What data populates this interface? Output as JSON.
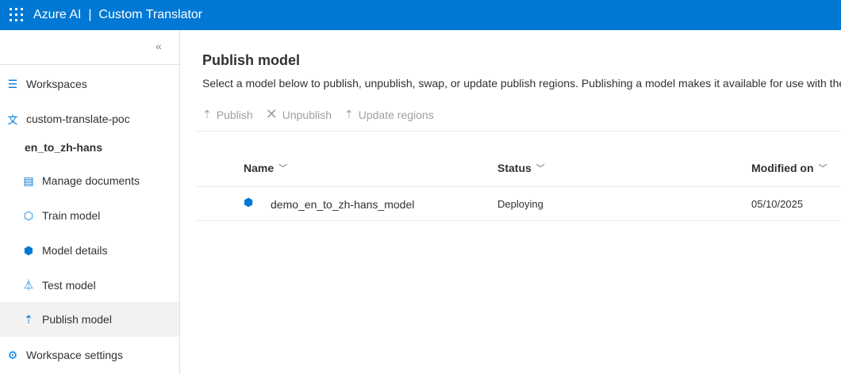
{
  "header": {
    "brand": "Azure AI",
    "separator": "|",
    "product": "Custom Translator"
  },
  "sidebar": {
    "collapse_icon": "«",
    "items": [
      {
        "label": "Workspaces",
        "icon": "menu-icon"
      },
      {
        "label": "custom-translate-poc",
        "icon": "translate-icon"
      },
      {
        "label": "en_to_zh-hans",
        "icon": ""
      },
      {
        "label": "Manage documents",
        "icon": "document-icon"
      },
      {
        "label": "Train model",
        "icon": "train-icon"
      },
      {
        "label": "Model details",
        "icon": "cube-icon"
      },
      {
        "label": "Test model",
        "icon": "flask-icon"
      },
      {
        "label": "Publish model",
        "icon": "publish-icon"
      },
      {
        "label": "Workspace settings",
        "icon": "gear-icon"
      }
    ]
  },
  "main": {
    "title": "Publish model",
    "description": "Select a model below to publish, unpublish, swap, or update publish regions. Publishing a model makes it available for use with the",
    "toolbar": {
      "publish": "Publish",
      "unpublish": "Unpublish",
      "update_regions": "Update regions"
    },
    "table": {
      "columns": [
        "Name",
        "Status",
        "Modified on"
      ],
      "rows": [
        {
          "name": "demo_en_to_zh-hans_model",
          "status": "Deploying",
          "modified": "05/10/2025"
        }
      ]
    }
  },
  "colors": {
    "brand": "#0078d4",
    "selected": "#f3f2f1"
  }
}
